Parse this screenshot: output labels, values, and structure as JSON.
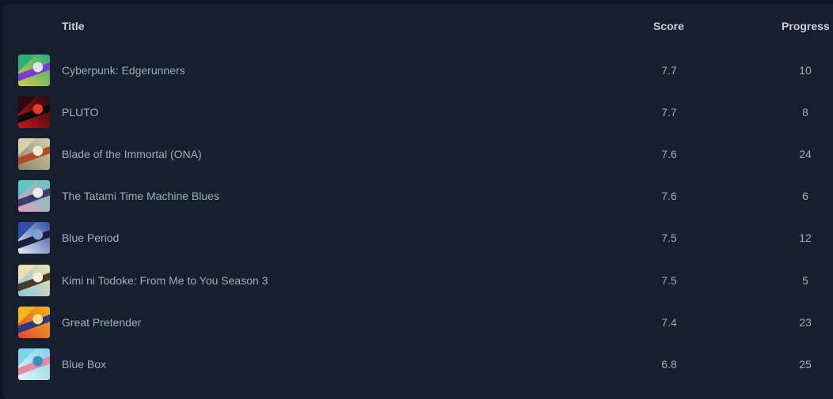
{
  "table": {
    "headers": {
      "title": "Title",
      "score": "Score",
      "progress": "Progress"
    },
    "rows": [
      {
        "title": "Cyberpunk: Edgerunners",
        "score": "7.7",
        "progress": "10",
        "cover_colors": [
          "#2fae7a",
          "#d8c84e",
          "#7a3bd1",
          "#e2e2ec"
        ]
      },
      {
        "title": "PLUTO",
        "score": "7.7",
        "progress": "8",
        "cover_colors": [
          "#2a0a0c",
          "#c4161c",
          "#0d0d10",
          "#e43a2e"
        ]
      },
      {
        "title": "Blade of the Immortal (ONA)",
        "score": "7.6",
        "progress": "24",
        "cover_colors": [
          "#d8cfb0",
          "#8a8260",
          "#b04a2a",
          "#efe8d2"
        ]
      },
      {
        "title": "The Tatami Time Machine Blues",
        "score": "7.6",
        "progress": "6",
        "cover_colors": [
          "#5fc6c2",
          "#e99fbf",
          "#3b3b6e",
          "#f1e9f3"
        ]
      },
      {
        "title": "Blue Period",
        "score": "7.5",
        "progress": "12",
        "cover_colors": [
          "#2d4fa6",
          "#e8edf6",
          "#1b1f3b",
          "#7fa3d9"
        ]
      },
      {
        "title": "Kimi ni Todoke: From Me to You Season 3",
        "score": "7.5",
        "progress": "5",
        "cover_colors": [
          "#eddfae",
          "#8fc6d6",
          "#4a3a2c",
          "#f5efe0"
        ]
      },
      {
        "title": "Great Pretender",
        "score": "7.4",
        "progress": "23",
        "cover_colors": [
          "#f1b51b",
          "#e2452f",
          "#2c3a7c",
          "#f7e08a"
        ]
      },
      {
        "title": "Blue Box",
        "score": "6.8",
        "progress": "25",
        "cover_colors": [
          "#7fd2e6",
          "#e8f4f7",
          "#e58aa5",
          "#3a8fbf"
        ]
      }
    ]
  }
}
